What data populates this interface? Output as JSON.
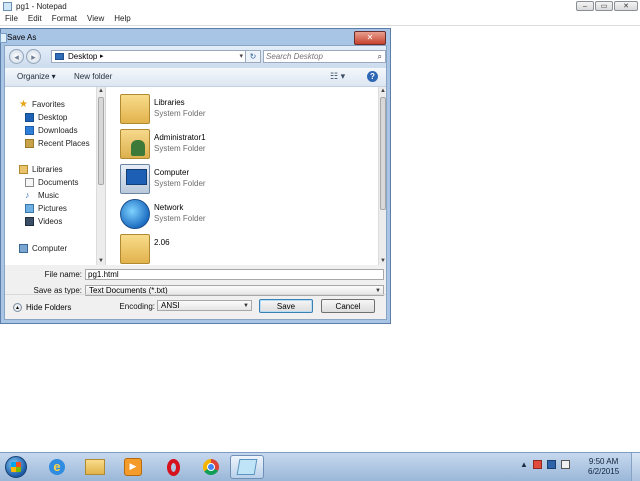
{
  "notepad": {
    "title": "pg1 - Notepad",
    "menu": [
      "File",
      "Edit",
      "Format",
      "View",
      "Help"
    ],
    "buttons": {
      "minimize": "–",
      "maximize": "▭",
      "close": "✕"
    }
  },
  "dialog": {
    "title": "Save As",
    "close": "✕",
    "address": {
      "location": "Desktop",
      "chevron": "▸",
      "dropdown": "▾"
    },
    "refresh": "↻",
    "search": {
      "placeholder": "Search Desktop",
      "icon": "search-icon"
    },
    "toolbar": {
      "organize": "Organize ▾",
      "new_folder": "New folder",
      "view": "☷ ▾",
      "help": "?"
    },
    "nav_pane": {
      "favorites_header": "Favorites",
      "favorites": [
        "Desktop",
        "Downloads",
        "Recent Places"
      ],
      "libraries_header": "Libraries",
      "libraries": [
        "Documents",
        "Music",
        "Pictures",
        "Videos"
      ],
      "computer": "Computer"
    },
    "files": [
      {
        "name": "Libraries",
        "type": "System Folder",
        "icon": "libraries-icon"
      },
      {
        "name": "Administrator1",
        "type": "System Folder",
        "icon": "user-folder-icon"
      },
      {
        "name": "Computer",
        "type": "System Folder",
        "icon": "computer-icon"
      },
      {
        "name": "Network",
        "type": "System Folder",
        "icon": "network-icon"
      },
      {
        "name": "2.06",
        "type": "",
        "icon": "folder-icon"
      }
    ],
    "file_name_label": "File name:",
    "file_name_value": "pg1.html",
    "save_type_label": "Save as type:",
    "save_type_value": "Text Documents (*.txt)",
    "encoding_label": "Encoding:",
    "encoding_value": "ANSI",
    "hide_folders": "Hide Folders",
    "save_button": "Save",
    "cancel_button": "Cancel"
  },
  "taskbar": {
    "apps": [
      "start",
      "internet-explorer",
      "windows-explorer",
      "media-player",
      "opera",
      "chrome",
      "notepad"
    ],
    "clock_time": "9:50 AM",
    "clock_date": "6/2/2015"
  }
}
